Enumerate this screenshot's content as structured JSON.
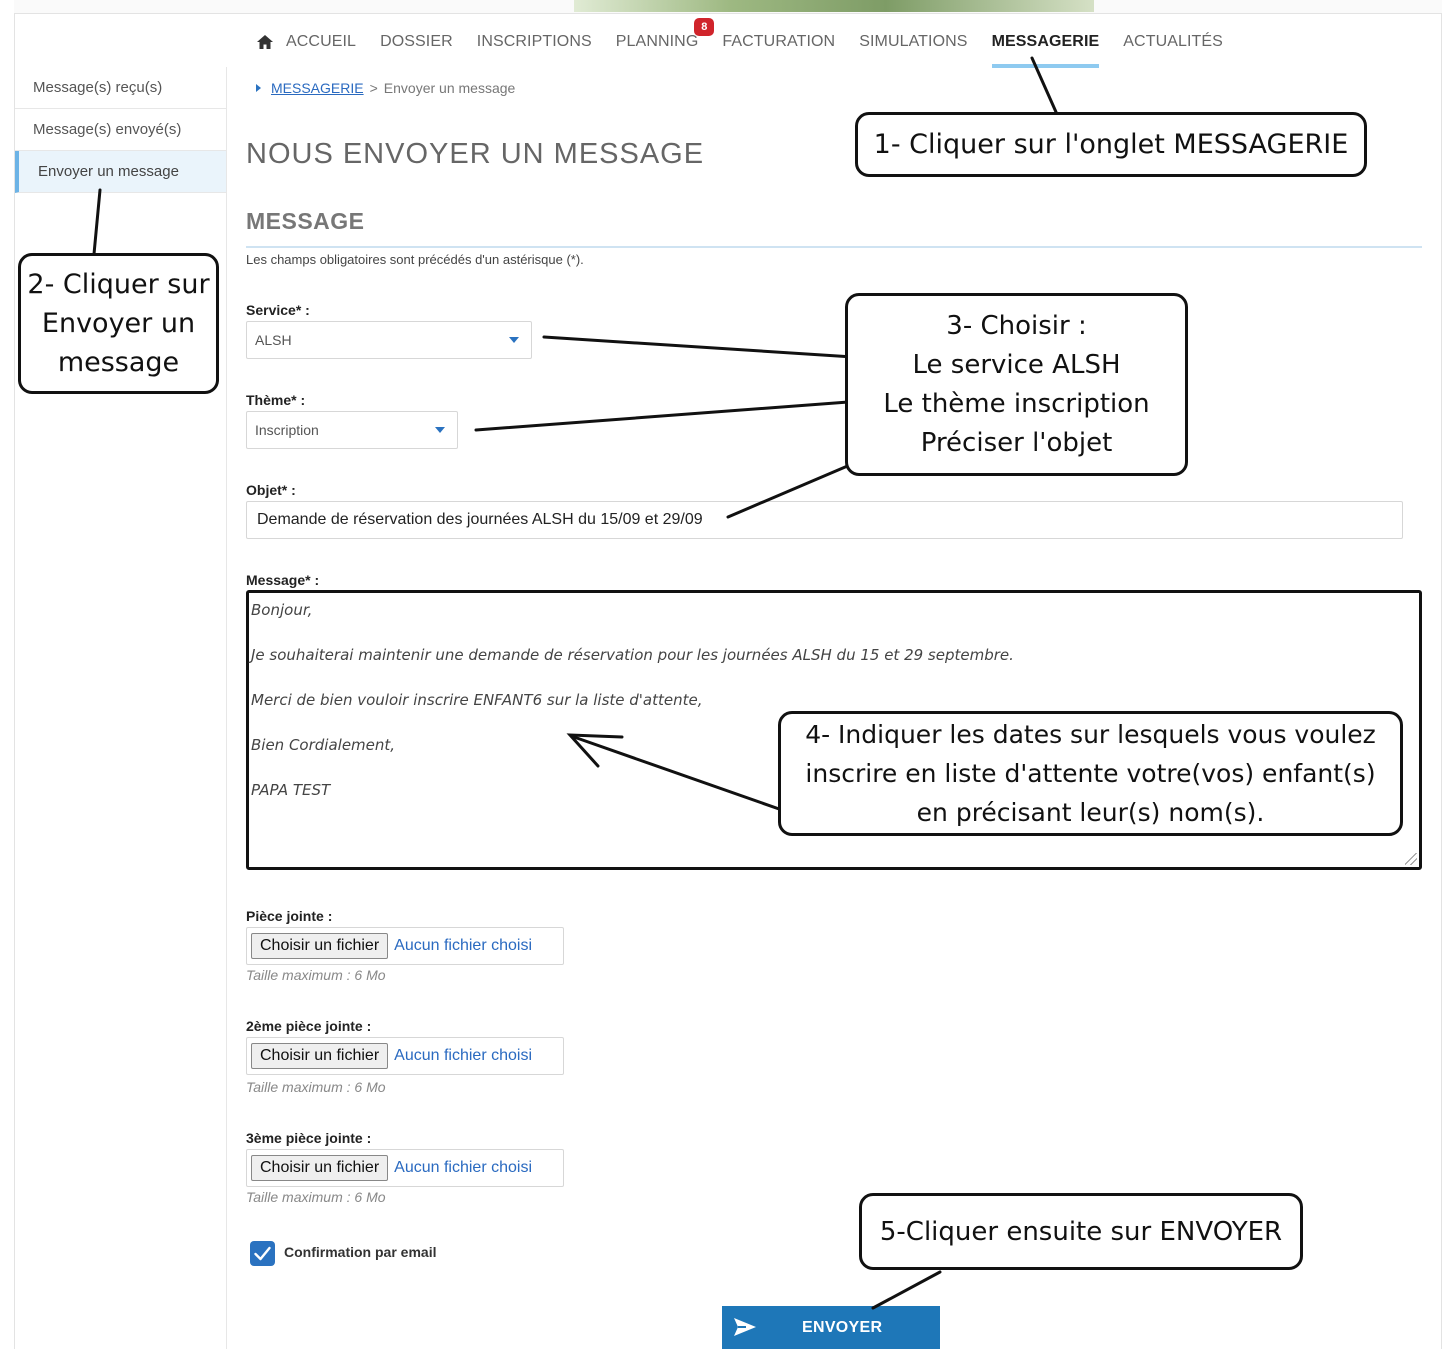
{
  "topnav": {
    "items": [
      {
        "label": "ACCUEIL",
        "icon": "home-icon"
      },
      {
        "label": "DOSSIER"
      },
      {
        "label": "INSCRIPTIONS"
      },
      {
        "label": "PLANNING",
        "badge": "8"
      },
      {
        "label": "FACTURATION"
      },
      {
        "label": "SIMULATIONS"
      },
      {
        "label": "MESSAGERIE",
        "active": true
      },
      {
        "label": "ACTUALITÉS"
      }
    ]
  },
  "sidebar": {
    "items": [
      {
        "label": "Message(s) reçu(s)"
      },
      {
        "label": "Message(s) envoyé(s)"
      },
      {
        "label": "Envoyer un message",
        "active": true
      }
    ]
  },
  "breadcrumb": {
    "link": "MESSAGERIE",
    "separator": ">",
    "current": "Envoyer un message"
  },
  "page_title": "NOUS ENVOYER UN MESSAGE",
  "section_title": "MESSAGE",
  "required_note": "Les champs obligatoires sont précédés d'un astérisque (*).",
  "form": {
    "service": {
      "label": "Service* :",
      "value": "ALSH"
    },
    "theme": {
      "label": "Thème* :",
      "value": "Inscription"
    },
    "objet": {
      "label": "Objet* :",
      "value": "Demande de réservation des journées ALSH du 15/09 et 29/09"
    },
    "message": {
      "label": "Message* :",
      "lines": [
        "Bonjour,",
        "Je souhaiterai maintenir une demande de réservation pour les journées ALSH du 15 et 29 septembre.",
        "Merci de bien vouloir inscrire ENFANT6 sur la liste d'attente,",
        "Bien Cordialement,",
        "PAPA TEST"
      ]
    },
    "attachments": [
      {
        "label": "Pièce jointe :",
        "button": "Choisir un fichier",
        "status": "Aucun fichier choisi",
        "help": "Taille maximum : 6 Mo"
      },
      {
        "label": "2ème pièce jointe :",
        "button": "Choisir un fichier",
        "status": "Aucun fichier choisi",
        "help": "Taille maximum : 6 Mo"
      },
      {
        "label": "3ème pièce jointe :",
        "button": "Choisir un fichier",
        "status": "Aucun fichier choisi",
        "help": "Taille maximum : 6 Mo"
      }
    ],
    "confirmation": {
      "label": "Confirmation par email",
      "checked": true
    },
    "submit_label": "ENVOYER"
  },
  "annotations": {
    "step1": [
      "1- Cliquer sur l'onglet MESSAGERIE"
    ],
    "step2": [
      "2- Cliquer sur",
      "Envoyer un",
      "message"
    ],
    "step3": [
      "3- Choisir :",
      "Le service ALSH",
      "Le thème inscription",
      "Préciser l'objet"
    ],
    "step4": [
      "4- Indiquer les dates sur lesquels vous voulez",
      "inscrire en liste d'attente votre(vos) enfant(s)",
      "en précisant leur(s) nom(s)."
    ],
    "step5": [
      "5-Cliquer ensuite sur ENVOYER"
    ]
  },
  "colors": {
    "accent": "#1e77b8",
    "nav_underline": "#8ecaf0",
    "badge": "#d0242b",
    "link": "#2a6ac0"
  }
}
